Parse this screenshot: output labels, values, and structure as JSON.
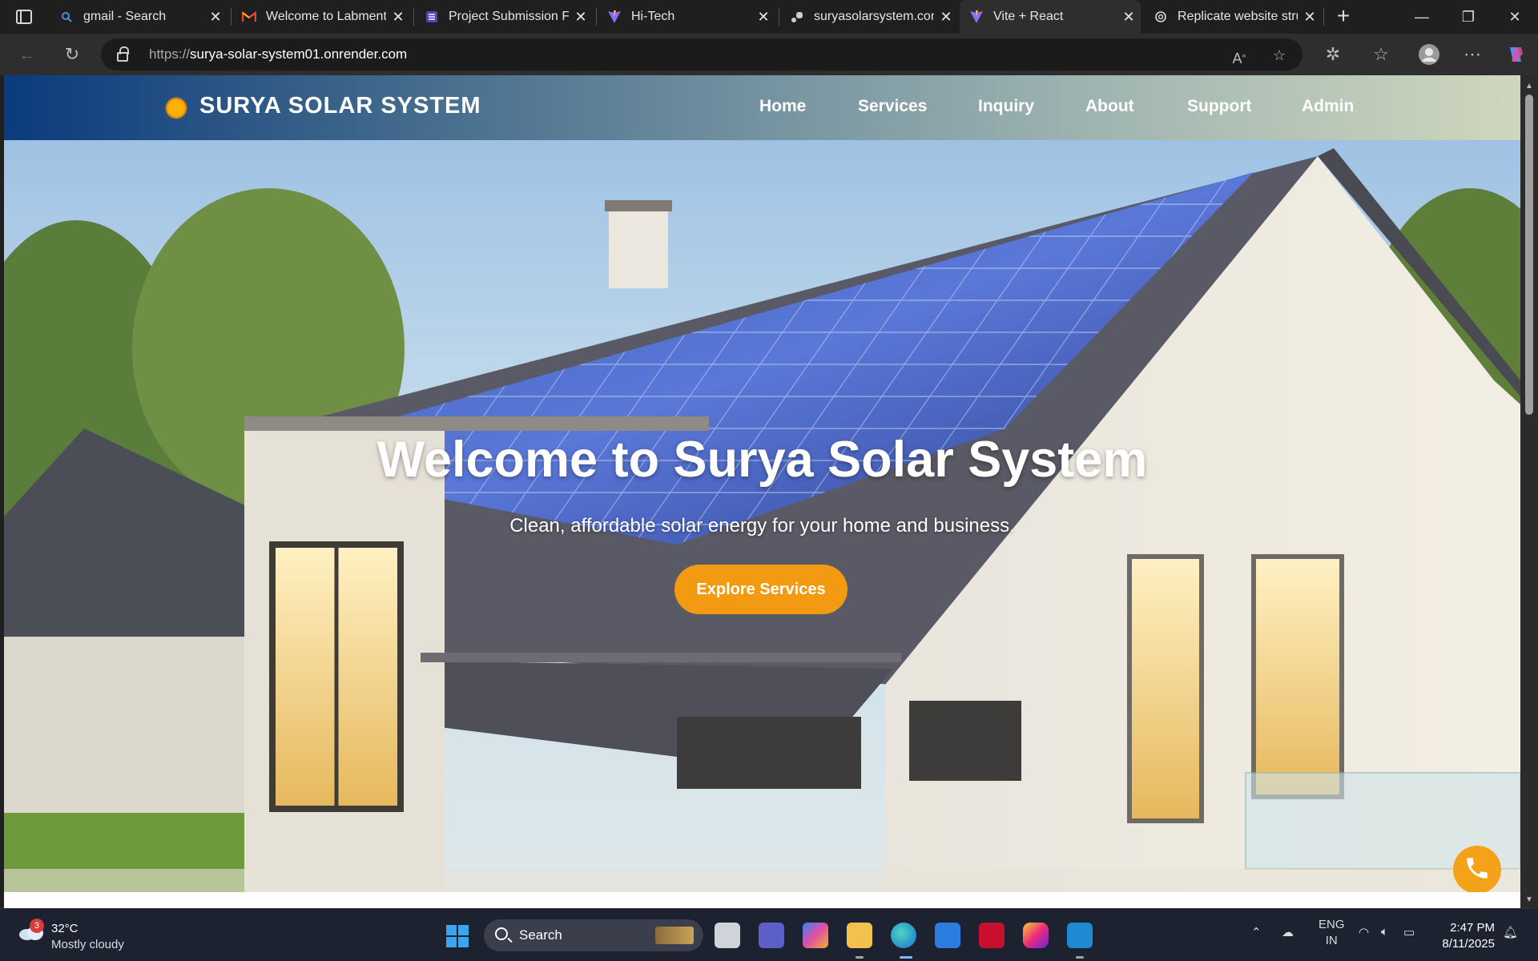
{
  "tabs": [
    {
      "title": "gmail - Search",
      "icon": "search-favicon"
    },
    {
      "title": "Welcome to Labmentix",
      "icon": "gmail-favicon"
    },
    {
      "title": "Project Submission Form",
      "icon": "forms-favicon"
    },
    {
      "title": "Hi-Tech",
      "icon": "vite-favicon"
    },
    {
      "title": "suryasolarsystem.com",
      "icon": "render-favicon"
    },
    {
      "title": "Vite + React",
      "icon": "vite-favicon",
      "active": true
    },
    {
      "title": "Replicate website structure",
      "icon": "chatgpt-favicon"
    }
  ],
  "address": {
    "protocol": "https://",
    "host": "surya-solar-system01.onrender.com"
  },
  "site": {
    "brand": "SURYA SOLAR SYSTEM",
    "nav": [
      "Home",
      "Services",
      "Inquiry",
      "About",
      "Support",
      "Admin"
    ],
    "hero": {
      "title": "Welcome to Surya Solar System",
      "subtitle": "Clean, affordable solar energy for your home and business.",
      "cta": "Explore Services"
    }
  },
  "taskbar": {
    "weather": {
      "temp": "32°C",
      "condition": "Mostly cloudy",
      "badge": "3"
    },
    "search_label": "Search",
    "lang": "ENG",
    "region": "IN",
    "time": "2:47 PM",
    "date": "8/11/2025"
  },
  "colors": {
    "accent": "#f29b12",
    "header_start": "#0b3a7e",
    "whatsapp": "#25d366"
  }
}
